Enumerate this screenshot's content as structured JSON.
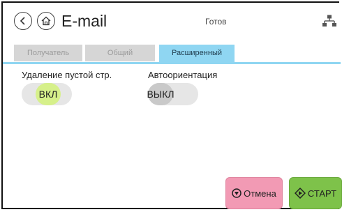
{
  "header": {
    "title": "E-mail",
    "status": "Готов",
    "icons": [
      "back-arrow-icon",
      "home-icon",
      "network-icon"
    ]
  },
  "tabs": [
    {
      "label": "Получатель",
      "active": false
    },
    {
      "label": "Общий",
      "active": false
    },
    {
      "label": "Расширенный",
      "active": true
    }
  ],
  "settings": [
    {
      "label": "Удаление пустой стр.",
      "value": "ВКЛ",
      "state": "on"
    },
    {
      "label": "Автоориентация",
      "value": "ВЫКЛ",
      "state": "off"
    }
  ],
  "actions": {
    "cancel_label": "Отмена",
    "start_label": "СТАРТ"
  },
  "colors": {
    "tab_active": "#8fd6f2",
    "toggle_on": "#d6f08a",
    "cancel": "#f29ab4",
    "start": "#7ec24a"
  }
}
